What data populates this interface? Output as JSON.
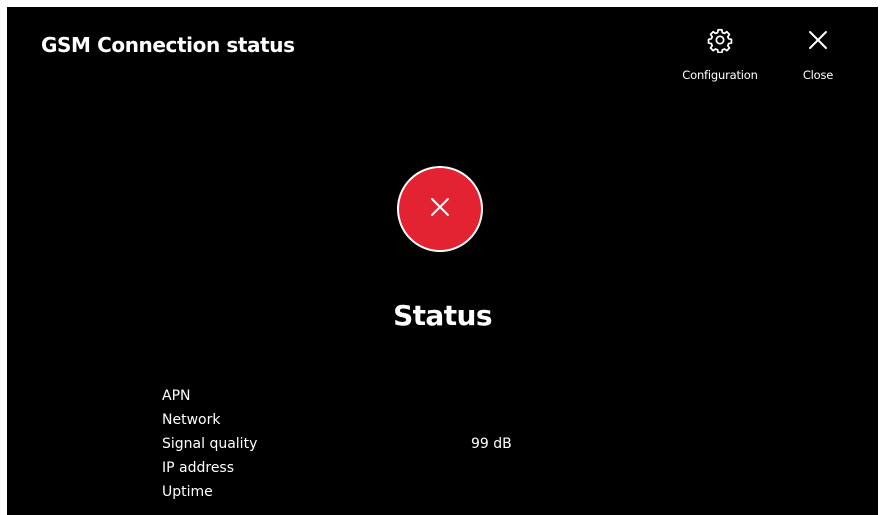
{
  "header": {
    "title": "GSM Connection status",
    "configuration_label": "Configuration",
    "close_label": "Close"
  },
  "status": {
    "title": "Status",
    "state_icon": "error-x-icon",
    "state_color": "#e32232"
  },
  "details": [
    {
      "label": "APN",
      "value": ""
    },
    {
      "label": "Network",
      "value": ""
    },
    {
      "label": "Signal quality",
      "value": "99 dB"
    },
    {
      "label": "IP address",
      "value": ""
    },
    {
      "label": "Uptime",
      "value": ""
    }
  ],
  "colors": {
    "background": "#000000",
    "text": "#ffffff",
    "error": "#e32232"
  }
}
